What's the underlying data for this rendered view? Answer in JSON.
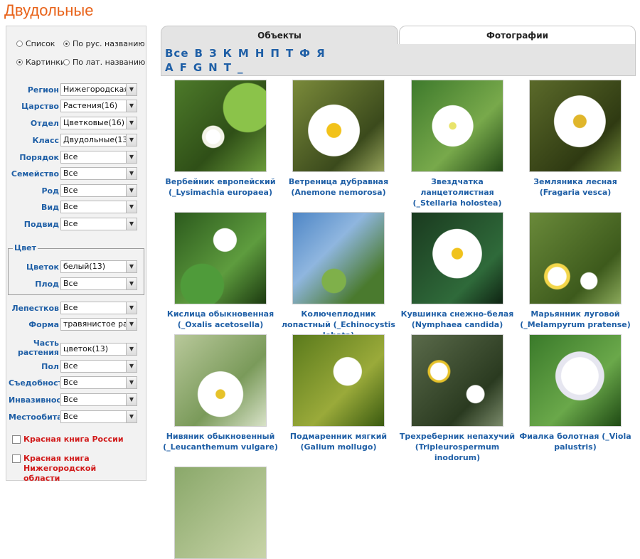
{
  "page": {
    "title": "Двудольные"
  },
  "view_options": {
    "list": "Список",
    "pictures": "Картинки",
    "by_rus": "По рус. названию",
    "by_lat": "По лат. названию",
    "selected_view": "pictures",
    "selected_sort": "by_rus"
  },
  "filters": [
    {
      "label": "Регион",
      "value": "Нижегородская о"
    },
    {
      "label": "Царство",
      "value": "Растения(16)"
    },
    {
      "label": "Отдел",
      "value": "Цветковые(16)"
    },
    {
      "label": "Класс",
      "value": "Двудольные(13)"
    },
    {
      "label": "Порядок",
      "value": "Все"
    },
    {
      "label": "Семейство",
      "value": "Все"
    },
    {
      "label": "Род",
      "value": "Все"
    },
    {
      "label": "Вид",
      "value": "Все"
    },
    {
      "label": "Подвид",
      "value": "Все"
    }
  ],
  "color_group": {
    "legend": "Цвет",
    "filters": [
      {
        "label": "Цветок",
        "value": "белый(13)"
      },
      {
        "label": "Плод",
        "value": "Все"
      }
    ]
  },
  "filters2": [
    {
      "label": "Лепестков",
      "value": "Все"
    },
    {
      "label": "Форма",
      "value": "травянистое рас"
    },
    {
      "label": "Часть растения",
      "value": "цветок(13)"
    },
    {
      "label": "Пол",
      "value": "Все"
    },
    {
      "label": "Съедобность",
      "value": "Все"
    },
    {
      "label": "Инвазивность",
      "value": "Все"
    },
    {
      "label": "Местообитание",
      "value": "Все"
    }
  ],
  "checkboxes": [
    {
      "label": "Красная книга России"
    },
    {
      "label": "Красная книга Нижегородской области"
    }
  ],
  "tabs": [
    {
      "label": "Объекты"
    },
    {
      "label": "Фотографии"
    }
  ],
  "letters_ru": [
    "Все",
    "В",
    "З",
    "К",
    "М",
    "Н",
    "П",
    "Т",
    "Ф",
    "Я"
  ],
  "letters_lat": [
    "A",
    "F",
    "G",
    "N",
    "T",
    "_"
  ],
  "items": [
    {
      "name": "Вербейник европейский (_Lysimachia europaea)",
      "icon": "flower-photo"
    },
    {
      "name": "Ветреница дубравная (Anemone nemorosa)",
      "icon": "flower-photo"
    },
    {
      "name": "Звездчатка ланцетолистная (_Stellaria holostea)",
      "icon": "flower-photo"
    },
    {
      "name": "Земляника лесная (Fragaria vesca)",
      "icon": "flower-photo"
    },
    {
      "name": "Кислица обыкновенная (_Oxalis acetosella)",
      "icon": "flower-photo"
    },
    {
      "name": "Колючеплодник лопастный (_Echinocystis lobata)",
      "icon": "flower-photo"
    },
    {
      "name": "Кувшинка снежно-белая (Nymphaea candida)",
      "icon": "flower-photo"
    },
    {
      "name": "Марьянник луговой (_Melampyrum pratense)",
      "icon": "flower-photo"
    },
    {
      "name": "Нивяник обыкновенный (_Leucanthemum vulgare)",
      "icon": "flower-photo"
    },
    {
      "name": "Подмаренник мягкий (Galium mollugo)",
      "icon": "flower-photo"
    },
    {
      "name": "Трехреберник непахучий (Tripleurospermum inodorum)",
      "icon": "flower-photo"
    },
    {
      "name": "Фиалка болотная (_Viola palustris)",
      "icon": "flower-photo"
    }
  ],
  "colors": {
    "accent_title": "#e8631a",
    "link": "#1f5fa6",
    "red_label": "#d11a1a"
  }
}
